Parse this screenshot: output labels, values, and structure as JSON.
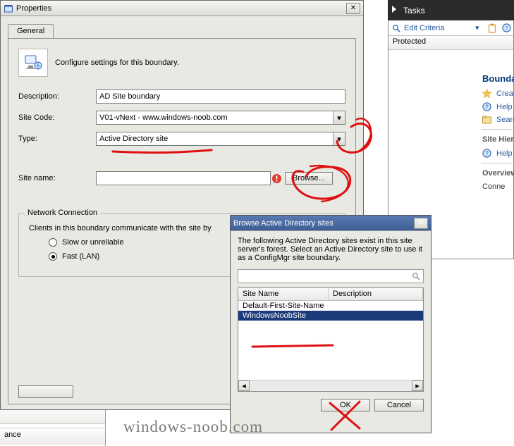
{
  "props": {
    "title": "Properties",
    "tab": "General",
    "intro": "Configure settings for this boundary.",
    "labels": {
      "description": "Description:",
      "sitecode": "Site Code:",
      "type": "Type:",
      "sitename": "Site name:",
      "browse": "Browse..."
    },
    "values": {
      "description": "AD Site boundary",
      "sitecode": "V01-vNext - www.windows-noob.com",
      "type": "Active Directory site",
      "sitename": ""
    },
    "network": {
      "legend": "Network Connection",
      "desc": "Clients in this boundary communicate with the site by",
      "slow": "Slow or unreliable",
      "fast": "Fast (LAN)",
      "selected": "fast"
    }
  },
  "browse": {
    "title": "Browse Active Directory sites",
    "intro": "The following Active Directory sites exist in this site server's forest. Select an Active Directory site to use it as a ConfigMgr site boundary.",
    "columns": {
      "name": "Site Name",
      "desc": "Description"
    },
    "rows": [
      {
        "name": "Default-First-Site-Name",
        "desc": ""
      },
      {
        "name": "WindowsNoobSite",
        "desc": ""
      }
    ],
    "selectedIndex": 1,
    "buttons": {
      "ok": "OK",
      "cancel": "Cancel"
    }
  },
  "rightbg": {
    "tasksHeader": "Tasks",
    "editCriteria": "Edit Criteria",
    "columnHeader": "Protected",
    "panel": {
      "boundariesTitle": "Boundar",
      "items1": [
        "Create",
        "Help",
        "Search"
      ],
      "heading2": "Site Hiera",
      "items2": [
        "Help"
      ],
      "heading3": "Overview",
      "items3": [
        "Conne"
      ]
    }
  },
  "frag": {
    "label": "ance"
  },
  "watermark": "windows-noob.com"
}
